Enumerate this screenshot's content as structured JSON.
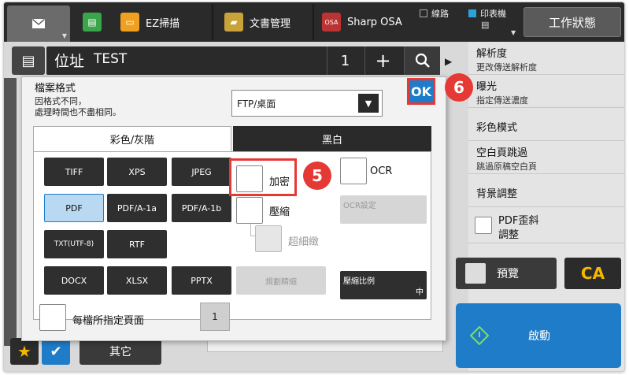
{
  "topbar": {
    "ez_scan": "EZ掃描",
    "doc_mgmt": "文書管理",
    "sharp_osa": "Sharp OSA",
    "line_label": "線路",
    "printer_label": "印表機",
    "status_button": "工作狀態"
  },
  "address": {
    "label": "位址",
    "value": "TEST",
    "count": "1",
    "plus": "+"
  },
  "side": {
    "resolution": "解析度",
    "resolution_sub": "更改傳送解析度",
    "exposure": "曝光",
    "exposure_sub": "指定傳送濃度",
    "color_mode": "彩色模式",
    "blank_skip": "空白頁跳過",
    "blank_skip_sub": "跳過原稿空白頁",
    "bg_adjust": "背景調整",
    "pdf_skew_1": "PDF歪斜",
    "pdf_skew_2": "調整",
    "preview": "預覽",
    "ca": "CA",
    "start": "啟動"
  },
  "bottom": {
    "other": "其它"
  },
  "dialog": {
    "title": "檔案格式",
    "subtitle_1": "因格式不同，",
    "subtitle_2": "處理時間也不盡相同。",
    "select_value": "FTP/桌面",
    "ok": "OK",
    "tab_color": "彩色/灰階",
    "tab_bw": "黑白",
    "formats": [
      "TIFF",
      "XPS",
      "JPEG",
      "PDF",
      "PDF/A-1a",
      "PDF/A-1b",
      "TXT(UTF-8)",
      "RTF",
      "DOCX",
      "XLSX",
      "PPTX"
    ],
    "selected_format": "PDF",
    "encrypt": "加密",
    "compress": "壓縮",
    "ultra_fine": "超細緻",
    "ocr": "OCR",
    "ocr_settings": "OCR設定",
    "standard_compression": "規劃精縮",
    "compress_ratio": "壓縮比例",
    "compress_ratio_value": "中",
    "pages_per_file": "每檔所指定頁面",
    "pages_value": "1"
  },
  "callouts": {
    "step5": "5",
    "step6": "6"
  }
}
